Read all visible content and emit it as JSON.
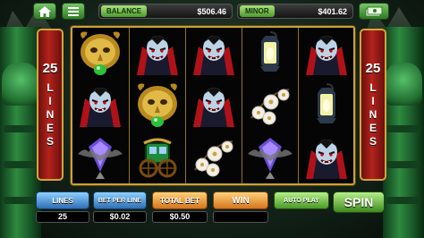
{
  "topbar": {
    "balance_label": "BALANCE",
    "balance_value": "$506.46",
    "minor_label": "MINOR",
    "minor_value": "$401.62"
  },
  "paylines": {
    "count": "25",
    "word": "LINES"
  },
  "controls": {
    "lines_label": "LINES",
    "lines_value": "25",
    "bet_per_line_label": "BET PER LINE",
    "bet_per_line_value": "$0.02",
    "total_bet_label": "TOTAL BET",
    "total_bet_value": "$0.50",
    "win_label": "WIN",
    "win_value": "",
    "auto_play_label": "AUTO PLAY",
    "spin_label": "SPIN"
  },
  "reels": [
    [
      "mask",
      "vampire",
      "bat-vial"
    ],
    [
      "vampire",
      "mask",
      "carriage"
    ],
    [
      "vampire",
      "vampire",
      "flowers"
    ],
    [
      "lantern",
      "flowers",
      "bat-vial"
    ],
    [
      "vampire",
      "lantern",
      "vampire"
    ]
  ],
  "colors": {
    "frame_gold": "#c9a23a",
    "lines_panel_red": "#b4241b",
    "button_green": "#4a9a27",
    "button_blue": "#2e6fb6",
    "button_orange": "#d4761d"
  }
}
